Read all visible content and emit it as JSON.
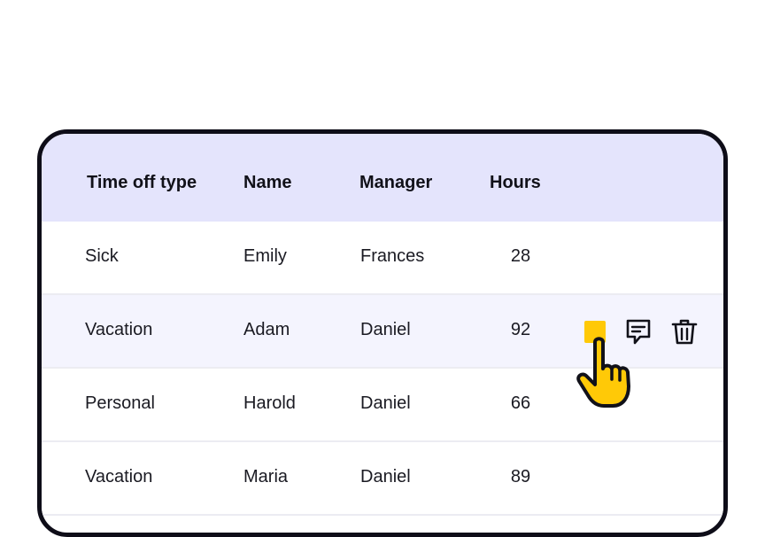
{
  "table": {
    "headers": [
      "Time off type",
      "Name",
      "Manager",
      "Hours"
    ],
    "rows": [
      {
        "type": "Sick",
        "name": "Emily",
        "manager": "Frances",
        "hours": "28"
      },
      {
        "type": "Vacation",
        "name": "Adam",
        "manager": "Daniel",
        "hours": "92"
      },
      {
        "type": "Personal",
        "name": "Harold",
        "manager": "Daniel",
        "hours": "66"
      },
      {
        "type": "Vacation",
        "name": "Maria",
        "manager": "Daniel",
        "hours": "89"
      }
    ]
  },
  "row_actions": {
    "icons": [
      "flag-icon",
      "comment-icon",
      "trash-icon"
    ],
    "highlighted_row": 1
  },
  "colors": {
    "header_bg": "#e4e4fc",
    "highlight_row_bg": "#f4f4fe",
    "accent": "#ffc907",
    "border": "#0e0d18"
  }
}
